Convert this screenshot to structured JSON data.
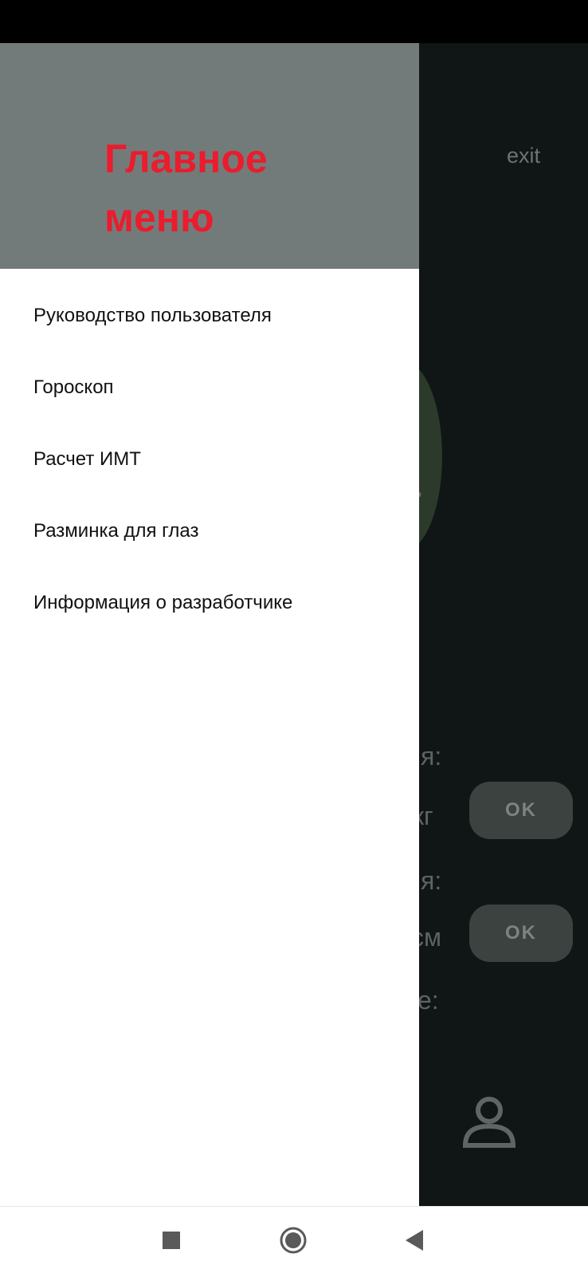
{
  "drawer": {
    "title": "Главное меню",
    "items": [
      {
        "label": "Руководство пользователя"
      },
      {
        "label": "Гороскоп"
      },
      {
        "label": "Расчет ИМТ"
      },
      {
        "label": "Разминка для глаз"
      },
      {
        "label": "Информация о разработчике"
      }
    ]
  },
  "background": {
    "exit_label": "exit",
    "row1_tail": "я:",
    "weight_unit_tail": "кг",
    "row2_tail": "я:",
    "height_unit_tail": "см",
    "row3_tail": "е:",
    "ok_button_1": "OK",
    "ok_button_2": "OK",
    "user_icon": "person-icon"
  },
  "system_nav": {
    "recents_icon": "square-icon",
    "home_icon": "circle-icon",
    "back_icon": "triangle-back-icon"
  },
  "colors": {
    "drawer_header_bg": "#737b7a",
    "drawer_title": "#ea1c2d",
    "scrim": "#101616"
  }
}
